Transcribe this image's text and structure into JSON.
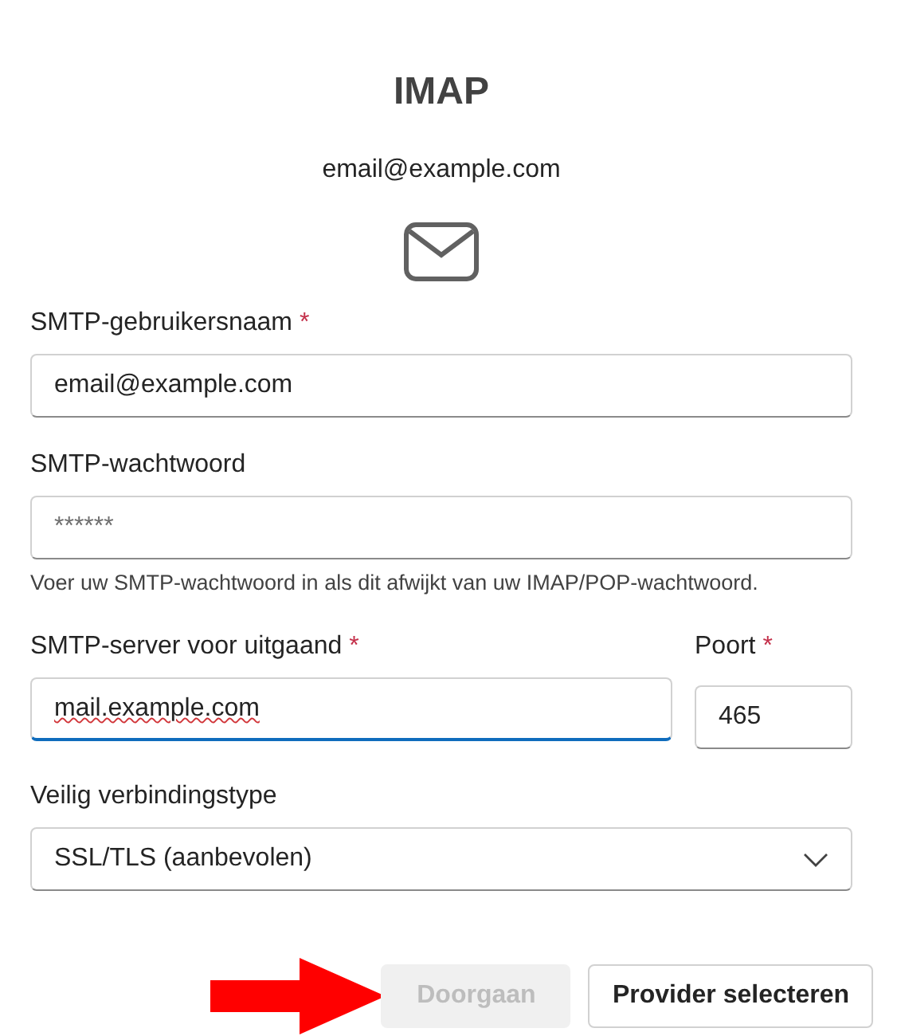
{
  "header": {
    "title": "IMAP",
    "account": "email@example.com"
  },
  "fields": [
    {
      "kind": "text",
      "label": "SMTP-gebruikersnaam",
      "required_mark": "*",
      "value": "email@example.com",
      "focused": false,
      "misspelled": false
    },
    {
      "kind": "password",
      "label": "SMTP-wachtwoord",
      "placeholder": "******",
      "hint": "Voer uw SMTP-wachtwoord in als dit afwijkt van uw IMAP/POP-wachtwoord.",
      "focused": false,
      "misspelled": false
    },
    {
      "kind": "pair",
      "items": [
        {
          "label": "SMTP-server voor uitgaand",
          "required_mark": "*",
          "value": "mail.example.com",
          "focused": true,
          "misspelled": true
        },
        {
          "label": "Poort",
          "required_mark": "*",
          "value": "465",
          "focused": false,
          "misspelled": false
        }
      ]
    },
    {
      "kind": "select",
      "label": "Veilig verbindingstype",
      "value": "SSL/TLS (aanbevolen)"
    }
  ],
  "buttons": [
    {
      "label": "Doorgaan",
      "disabled": true,
      "pointed_at": true
    },
    {
      "label": "Provider selecteren",
      "disabled": false,
      "pointed_at": false
    }
  ]
}
